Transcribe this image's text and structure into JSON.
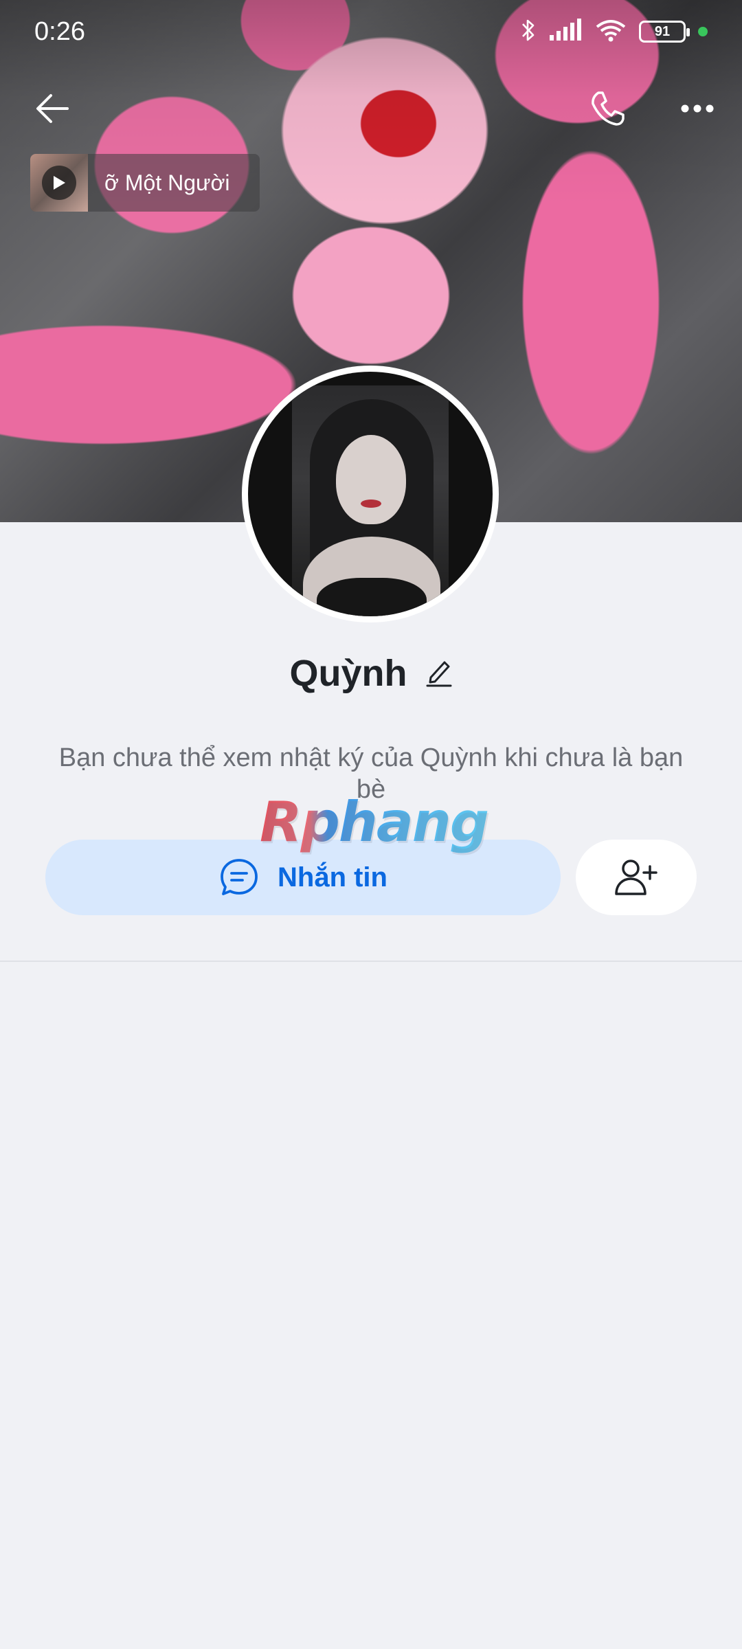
{
  "status_bar": {
    "time": "0:26",
    "battery_level": "91",
    "icons": [
      "bluetooth-icon",
      "signal-icon",
      "wifi-icon",
      "battery-icon",
      "active-dot-icon"
    ]
  },
  "top_nav": {
    "icons": [
      "back-arrow-icon",
      "phone-icon",
      "more-dots-icon"
    ]
  },
  "music": {
    "title": "ỡ Một Người",
    "icons": [
      "play-icon"
    ]
  },
  "profile": {
    "name": "Quỳnh",
    "info_text": "Bạn chưa thể xem nhật ký của Quỳnh khi chưa là bạn bè",
    "icons": [
      "edit-pencil-icon"
    ]
  },
  "watermark": {
    "text": "Rphang"
  },
  "actions": {
    "message_label": "Nhắn tin",
    "icons": [
      "chat-bubble-icon",
      "add-friend-icon"
    ]
  },
  "colors": {
    "background": "#f0f1f5",
    "accent": "#0a68e0",
    "message_button_bg": "#d8e8fd",
    "text_primary": "#1f2328",
    "text_secondary": "#6b6e75"
  }
}
